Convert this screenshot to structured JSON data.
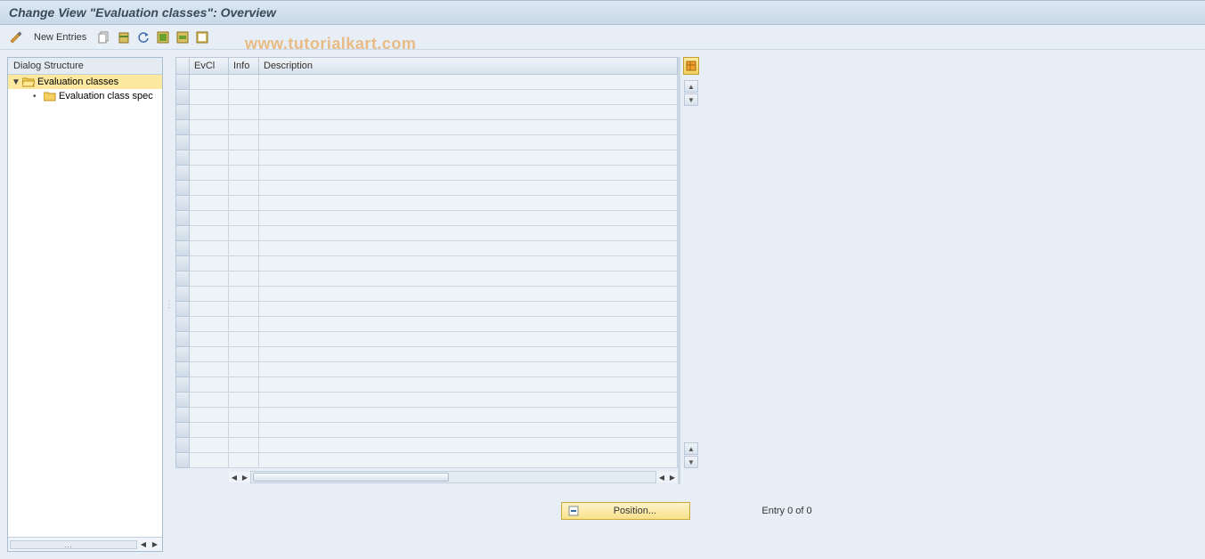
{
  "title": "Change View \"Evaluation classes\": Overview",
  "toolbar": {
    "new_entries_label": "New Entries"
  },
  "watermark": "www.tutorialkart.com",
  "tree": {
    "header": "Dialog Structure",
    "nodes": [
      {
        "label": "Evaluation classes",
        "selected": true,
        "open": true
      },
      {
        "label": "Evaluation class spec",
        "selected": false,
        "child": true
      }
    ]
  },
  "grid": {
    "columns": {
      "evcl": "EvCl",
      "info": "Info",
      "description": "Description"
    },
    "row_count": 26
  },
  "footer": {
    "position_label": "Position...",
    "entry_text": "Entry 0 of 0"
  }
}
